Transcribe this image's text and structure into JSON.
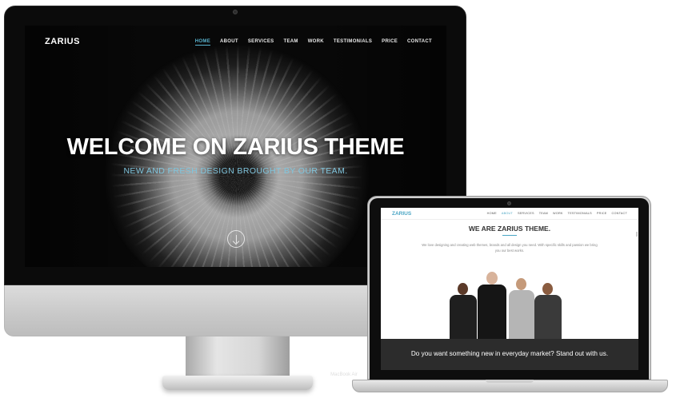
{
  "imac": {
    "logo": "ZARIUS",
    "nav": [
      "HOME",
      "ABOUT",
      "SERVICES",
      "TEAM",
      "WORK",
      "TESTIMONIALS",
      "PRICE",
      "CONTACT"
    ],
    "active_nav": "HOME",
    "hero_title": "WELCOME ON ZARIUS THEME",
    "hero_subtitle": "NEW AND FRESH DESIGN BROUGHT BY OUR TEAM."
  },
  "macbook": {
    "logo": "ZARIUS",
    "nav": [
      "HOME",
      "ABOUT",
      "SERVICES",
      "TEAM",
      "WORK",
      "TESTIMONIALS",
      "PRICE",
      "CONTACT"
    ],
    "active_nav": "ABOUT",
    "heading": "WE ARE ZARIUS THEME.",
    "intro": "We love designing and creating web themes, brands and all design you need. With specific skills and passion we bring you our best works.",
    "banner": "Do you want something new in everyday market? Stand out with us.",
    "brand": "MacBook Air"
  },
  "colors": {
    "accent": "#58b3cf",
    "hero_bg": "#080808",
    "banner_bg": "#2c2c2c"
  }
}
